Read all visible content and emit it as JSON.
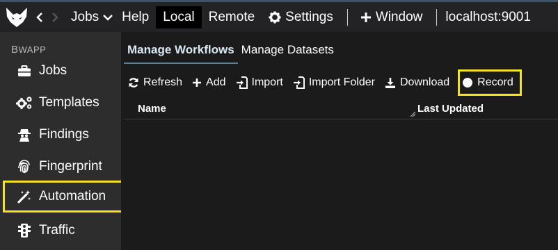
{
  "topbar": {
    "jobs_label": "Jobs",
    "help_label": "Help",
    "local_label": "Local",
    "remote_label": "Remote",
    "settings_label": "Settings",
    "window_label": "Window",
    "host_label": "localhost:9001"
  },
  "sidebar": {
    "app_label_first": "B",
    "app_label_rest": "WAPP",
    "items": [
      {
        "label": "Jobs",
        "icon": "briefcase-icon"
      },
      {
        "label": "Templates",
        "icon": "gears-icon"
      },
      {
        "label": "Findings",
        "icon": "spy-icon"
      },
      {
        "label": "Fingerprint",
        "icon": "fingerprint-icon"
      },
      {
        "label": "Automation",
        "icon": "magic-wand-icon",
        "highlighted": true
      },
      {
        "label": "Traffic",
        "icon": "traffic-light-icon"
      }
    ]
  },
  "main": {
    "tabs": [
      {
        "label": "Manage Workflows",
        "active": true
      },
      {
        "label": "Manage Datasets",
        "active": false
      }
    ],
    "toolbar": {
      "refresh_label": "Refresh",
      "add_label": "Add",
      "import_label": "Import",
      "import_folder_label": "Import Folder",
      "download_label": "Download",
      "record_label": "Record"
    },
    "columns": {
      "name": "Name",
      "last_updated": "Last Updated"
    }
  },
  "colors": {
    "highlight": "#f2e22a",
    "active_tab_underline": "#5d7f96",
    "sidebar_bg": "#2d2d2e",
    "main_bg": "#1b1b1c"
  }
}
